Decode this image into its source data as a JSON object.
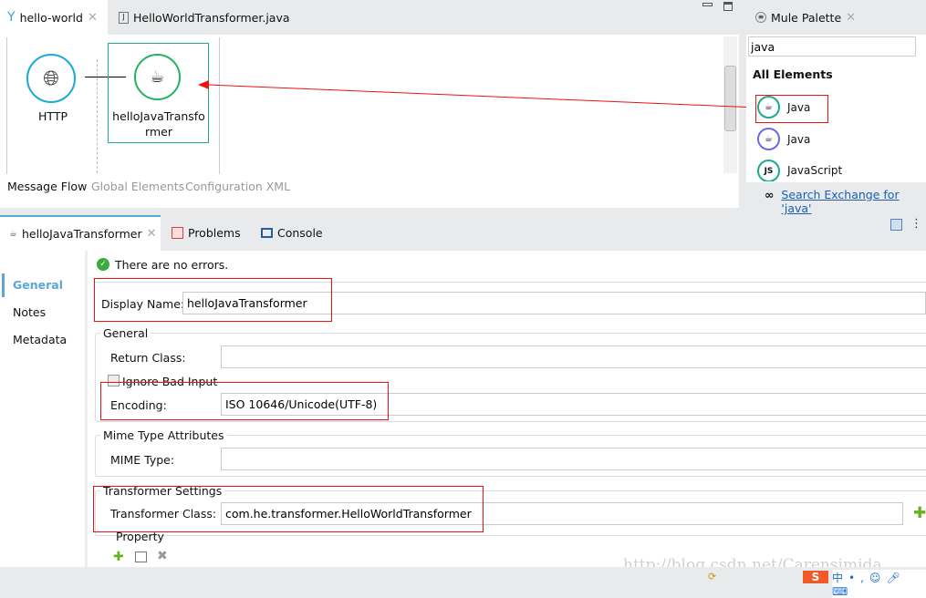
{
  "editor_tabs": [
    {
      "label": "hello-world",
      "active": true
    },
    {
      "label": "HelloWorldTransformer.java",
      "active": false
    }
  ],
  "canvas": {
    "nodes": [
      {
        "label": "HTTP"
      },
      {
        "label": "helloJavaTransfo rmer"
      }
    ],
    "bottom_tabs": [
      "Message Flow",
      "Global Elements",
      "Configuration XML"
    ]
  },
  "palette": {
    "title": "Mule Palette",
    "search_value": "java",
    "section": "All Elements",
    "items": [
      {
        "label": "Java",
        "color": "#1bab8c"
      },
      {
        "label": "Java",
        "color": "#6a6ae8"
      },
      {
        "label": "JavaScript",
        "color": "#1bab8c"
      }
    ],
    "exchange_link": "Search Exchange for 'java'"
  },
  "bottom_tabs": [
    {
      "label": "helloJavaTransformer",
      "active": true
    },
    {
      "label": "Problems"
    },
    {
      "label": "Console"
    }
  ],
  "side_nav": [
    {
      "label": "General",
      "active": true
    },
    {
      "label": "Notes"
    },
    {
      "label": "Metadata"
    }
  ],
  "status": "There are no errors.",
  "form": {
    "display_name_label": "Display Name:",
    "display_name_value": "helloJavaTransformer",
    "general_group": "General",
    "return_class_label": "Return Class:",
    "return_class_value": "",
    "ignore_bad_input_label": "Ignore Bad Input",
    "ignore_bad_input_checked": false,
    "encoding_label": "Encoding:",
    "encoding_value": "ISO 10646/Unicode(UTF-8)",
    "mime_group": "Mime Type Attributes",
    "mime_type_label": "MIME Type:",
    "mime_type_value": "",
    "transformer_group": "Transformer Settings",
    "transformer_class_label": "Transformer Class:",
    "transformer_class_value": "com.he.transformer.HelloWorldTransformer",
    "property_label": "Property"
  },
  "watermark": "http://blog.csdn.net/Carensimida",
  "colors": {
    "accent": "#5aa7d8",
    "highlight": "#e11111",
    "node_green": "#22b35e",
    "node_blue": "#1aa9d4"
  }
}
